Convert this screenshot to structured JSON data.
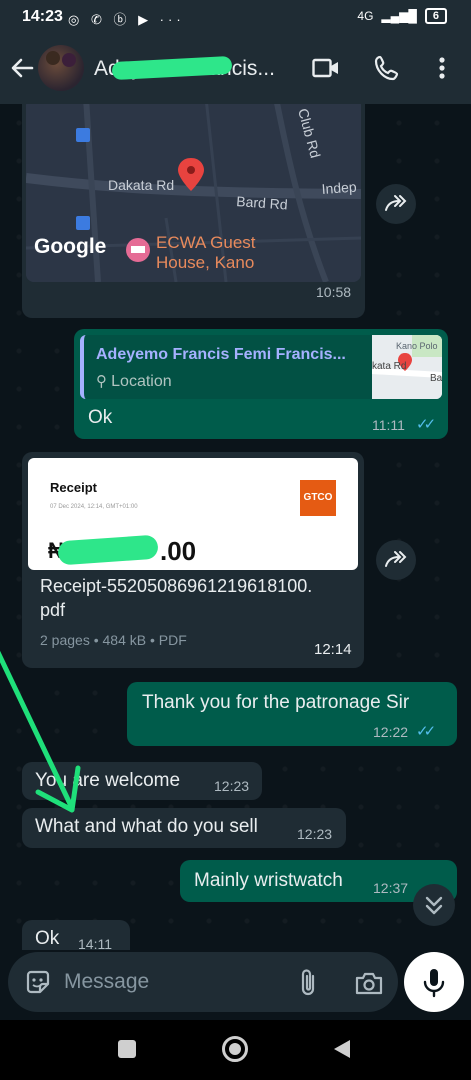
{
  "status_bar": {
    "time": "14:23",
    "left_icons": "◎ ✆ ⓑ ▶ ···",
    "network": "4G",
    "battery": "6"
  },
  "header": {
    "contact_name": "Adeyemo Francis..."
  },
  "messages": [
    {
      "id": "map",
      "direction": "incoming",
      "map_labels": {
        "road1": "Dakata Rd",
        "road2": "Bard Rd",
        "road3": "Indep",
        "road4": "Club Rd",
        "brand": "Google",
        "poi": "ECWA Guest",
        "poi2": "House, Kano"
      },
      "time": "10:58"
    },
    {
      "id": "location-reply",
      "direction": "outgoing",
      "quote_name": "Adeyemo Francis Femi Francis...",
      "quote_sub": "Location",
      "thumb_labels": {
        "a": "Kano Polo",
        "b": "kata Rd",
        "c": "Ba"
      },
      "text": "Ok",
      "time": "11:11"
    },
    {
      "id": "receipt",
      "direction": "incoming",
      "receipt_title": "Receipt",
      "receipt_date": "07 Dec 2024, 12:14, GMT+01:00",
      "receipt_logo": "GTCO",
      "receipt_amount_prefix": "₦",
      "receipt_amount_tail": ".00",
      "receipt_amount_cents": ".00",
      "file_name_line1": "Receipt-55205086961219618100.",
      "file_name_line2": "pdf",
      "file_meta": "2 pages • 484 kB • PDF",
      "time": "12:14"
    },
    {
      "id": "thanks",
      "direction": "outgoing",
      "text": "Thank you for the patronage Sir",
      "time": "12:22"
    },
    {
      "id": "welcome",
      "direction": "incoming",
      "text": "You are welcome",
      "time": "12:23"
    },
    {
      "id": "what-sell",
      "direction": "incoming",
      "text": "What and what do you sell",
      "time": "12:23"
    },
    {
      "id": "wristwatch",
      "direction": "outgoing",
      "text": "Mainly wristwatch",
      "time": "12:37"
    },
    {
      "id": "ok-partial",
      "direction": "incoming",
      "text": "Ok",
      "time": "14:11"
    }
  ],
  "composer": {
    "placeholder": "Message"
  },
  "colors": {
    "outgoing_bubble": "#005c4b",
    "incoming_bubble": "#1f2c34",
    "background": "#0b141a",
    "read_ticks": "#53bdeb",
    "annotation_arrow": "#1fe07a",
    "gtco_orange": "#e55b13"
  }
}
